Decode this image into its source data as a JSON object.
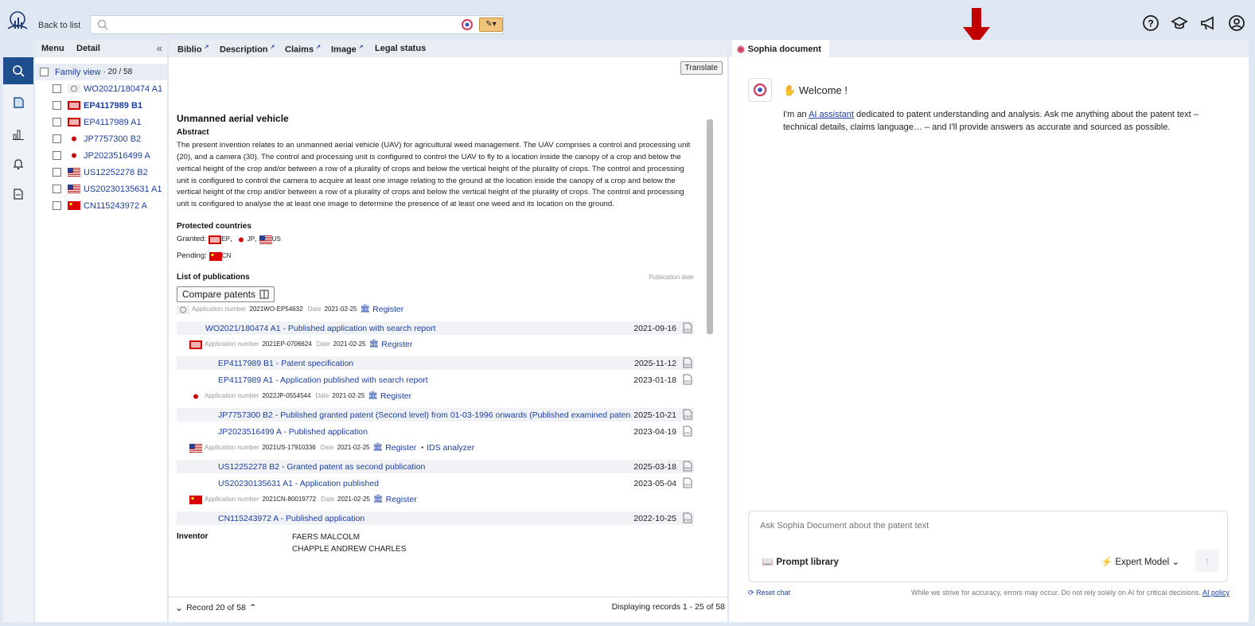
{
  "topbar": {
    "back_label": "Back to list",
    "search_placeholder": "",
    "highlight_label": "✎▾"
  },
  "left": {
    "tabs": [
      "Menu",
      "Detail"
    ],
    "family_label": "Family view",
    "family_count": "· 20 / 58",
    "items": [
      {
        "id": "WO2021/180474 A1",
        "flag": "wo",
        "bold": false
      },
      {
        "id": "EP4117989 B1",
        "flag": "eu",
        "bold": true
      },
      {
        "id": "EP4117989 A1",
        "flag": "eu",
        "bold": false
      },
      {
        "id": "JP7757300 B2",
        "flag": "jp",
        "bold": false
      },
      {
        "id": "JP2023516499 A",
        "flag": "jp",
        "bold": false
      },
      {
        "id": "US12252278 B2",
        "flag": "us",
        "bold": false
      },
      {
        "id": "US20230135631 A1",
        "flag": "us",
        "bold": false
      },
      {
        "id": "CN115243972 A",
        "flag": "cn",
        "bold": false
      }
    ]
  },
  "mid": {
    "tabs": [
      "Biblio",
      "Description",
      "Claims",
      "Image",
      "Legal status"
    ],
    "translate": "Translate",
    "title": "Unmanned aerial vehicle",
    "abstract_heading": "Abstract",
    "abstract": "The present invention relates to an unmanned aerial vehicle (UAV) for agricultural weed management. The UAV comprises a control and processing unit (20), and a camera (30). The control and processing unit is configured to control the UAV to fly to a location inside the canopy of a crop and below the vertical height of the crop and/or between a row of a plurality of crops and below the vertical height of the plurality of crops. The control and processing unit is configured to control the camera to acquire at least one image relating to the ground at the location inside the canopy of a crop and below the vertical height of the crop and/or between a row of a plurality of crops and below the vertical height of the plurality of crops. The control and processing unit is configured to analyse the at least one image to determine the presence of at least one weed and its location on the ground.",
    "protected_heading": "Protected countries",
    "granted_label": "Granted:",
    "granted": [
      "EP",
      "JP",
      "US"
    ],
    "pending_label": "Pending:",
    "pending": [
      "CN"
    ],
    "list_heading": "List of publications",
    "pubdate_label": "Publication date",
    "compare_label": "Compare patents",
    "app_label": "Application number",
    "date_label": "Date",
    "register": "Register",
    "ids": "IDS analyzer",
    "groups": [
      {
        "flag": "wo",
        "app": "2021WO-EP54632",
        "date": "2021-02-25",
        "ids": false,
        "pubs": [
          {
            "t": "WO2021/180474 A1 - Published application with search report",
            "d": "2021-09-16"
          }
        ]
      },
      {
        "flag": "eu",
        "app": "2021EP-0706624",
        "date": "2021-02-25",
        "ids": false,
        "pubs": [
          {
            "t": "EP4117989 B1 - Patent specification",
            "d": "2025-11-12"
          },
          {
            "t": "EP4117989 A1 - Application published with search report",
            "d": "2023-01-18"
          }
        ]
      },
      {
        "flag": "jp",
        "app": "2022JP-0554544",
        "date": "2021-02-25",
        "ids": false,
        "pubs": [
          {
            "t": "JP7757300 B2 - Published granted patent (Second level) from 01-03-1996 onwards (Published examined paten…",
            "d": "2025-10-21"
          },
          {
            "t": "JP2023516499 A - Published application",
            "d": "2023-04-19"
          }
        ]
      },
      {
        "flag": "us",
        "app": "2021US-17910336",
        "date": "2021-02-25",
        "ids": true,
        "pubs": [
          {
            "t": "US12252278 B2 - Granted patent as second publication",
            "d": "2025-03-18"
          },
          {
            "t": "US20230135631 A1 - Application published",
            "d": "2023-05-04"
          }
        ]
      },
      {
        "flag": "cn",
        "app": "2021CN-80019772",
        "date": "2021-02-25",
        "ids": false,
        "pubs": [
          {
            "t": "CN115243972 A - Published application",
            "d": "2022-10-25"
          }
        ]
      }
    ],
    "inventor_label": "Inventor",
    "inventors": [
      "FAERS MALCOLM",
      "CHAPPLE ANDREW CHARLES"
    ],
    "record": "Record 20 of 58",
    "displaying": "Displaying records 1 - 25 of 58"
  },
  "right": {
    "tab": "Sophia document",
    "welcome": "Welcome !",
    "intro_pre": "I'm an ",
    "intro_link": "AI assistant",
    "intro_post": " dedicated to patent understanding and analysis. Ask me anything about the patent text – technical details, claims language… – and I'll provide answers as accurate and sourced as possible.",
    "placeholder": "Ask Sophia Document about the patent text",
    "prompt_library": "Prompt library",
    "model": "Expert Model",
    "reset": "Reset chat",
    "disclaimer": "While we strive for accuracy, errors may occur. Do not rely solely on AI for critical decisions.",
    "policy": "AI policy"
  },
  "colors": {
    "accent": "#1b3fa3",
    "rail_active": "#1f4e8c",
    "arrow": "#c00000"
  }
}
